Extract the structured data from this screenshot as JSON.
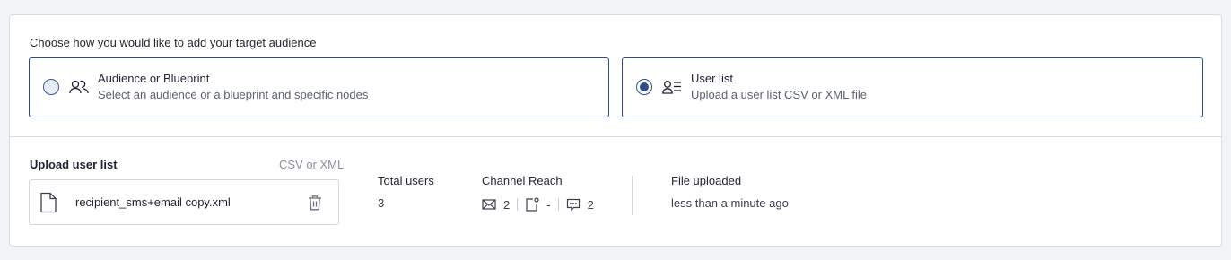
{
  "prompt": "Choose how you would like to add your target audience",
  "options": [
    {
      "title": "Audience or Blueprint",
      "subtitle": "Select an audience or a blueprint and specific nodes",
      "icon": "users-icon",
      "selected": false
    },
    {
      "title": "User list",
      "subtitle": "Upload a user list CSV or XML file",
      "icon": "user-list-icon",
      "selected": true
    }
  ],
  "upload": {
    "label": "Upload user list",
    "hint": "CSV or XML",
    "file_name": "recipient_sms+email copy.xml"
  },
  "stats": {
    "total_users_label": "Total users",
    "total_users_value": "3",
    "channel_reach_label": "Channel Reach",
    "channels": [
      {
        "icon": "email-icon",
        "value": "2"
      },
      {
        "icon": "push-notification-icon",
        "value": "-"
      },
      {
        "icon": "sms-icon",
        "value": "2"
      }
    ],
    "file_uploaded_label": "File uploaded",
    "file_uploaded_value": "less than a minute ago"
  },
  "colors": {
    "accent": "#2c4f8c",
    "border": "#d9dce1",
    "muted_text": "#5b6270",
    "background": "#f2f3f5"
  }
}
